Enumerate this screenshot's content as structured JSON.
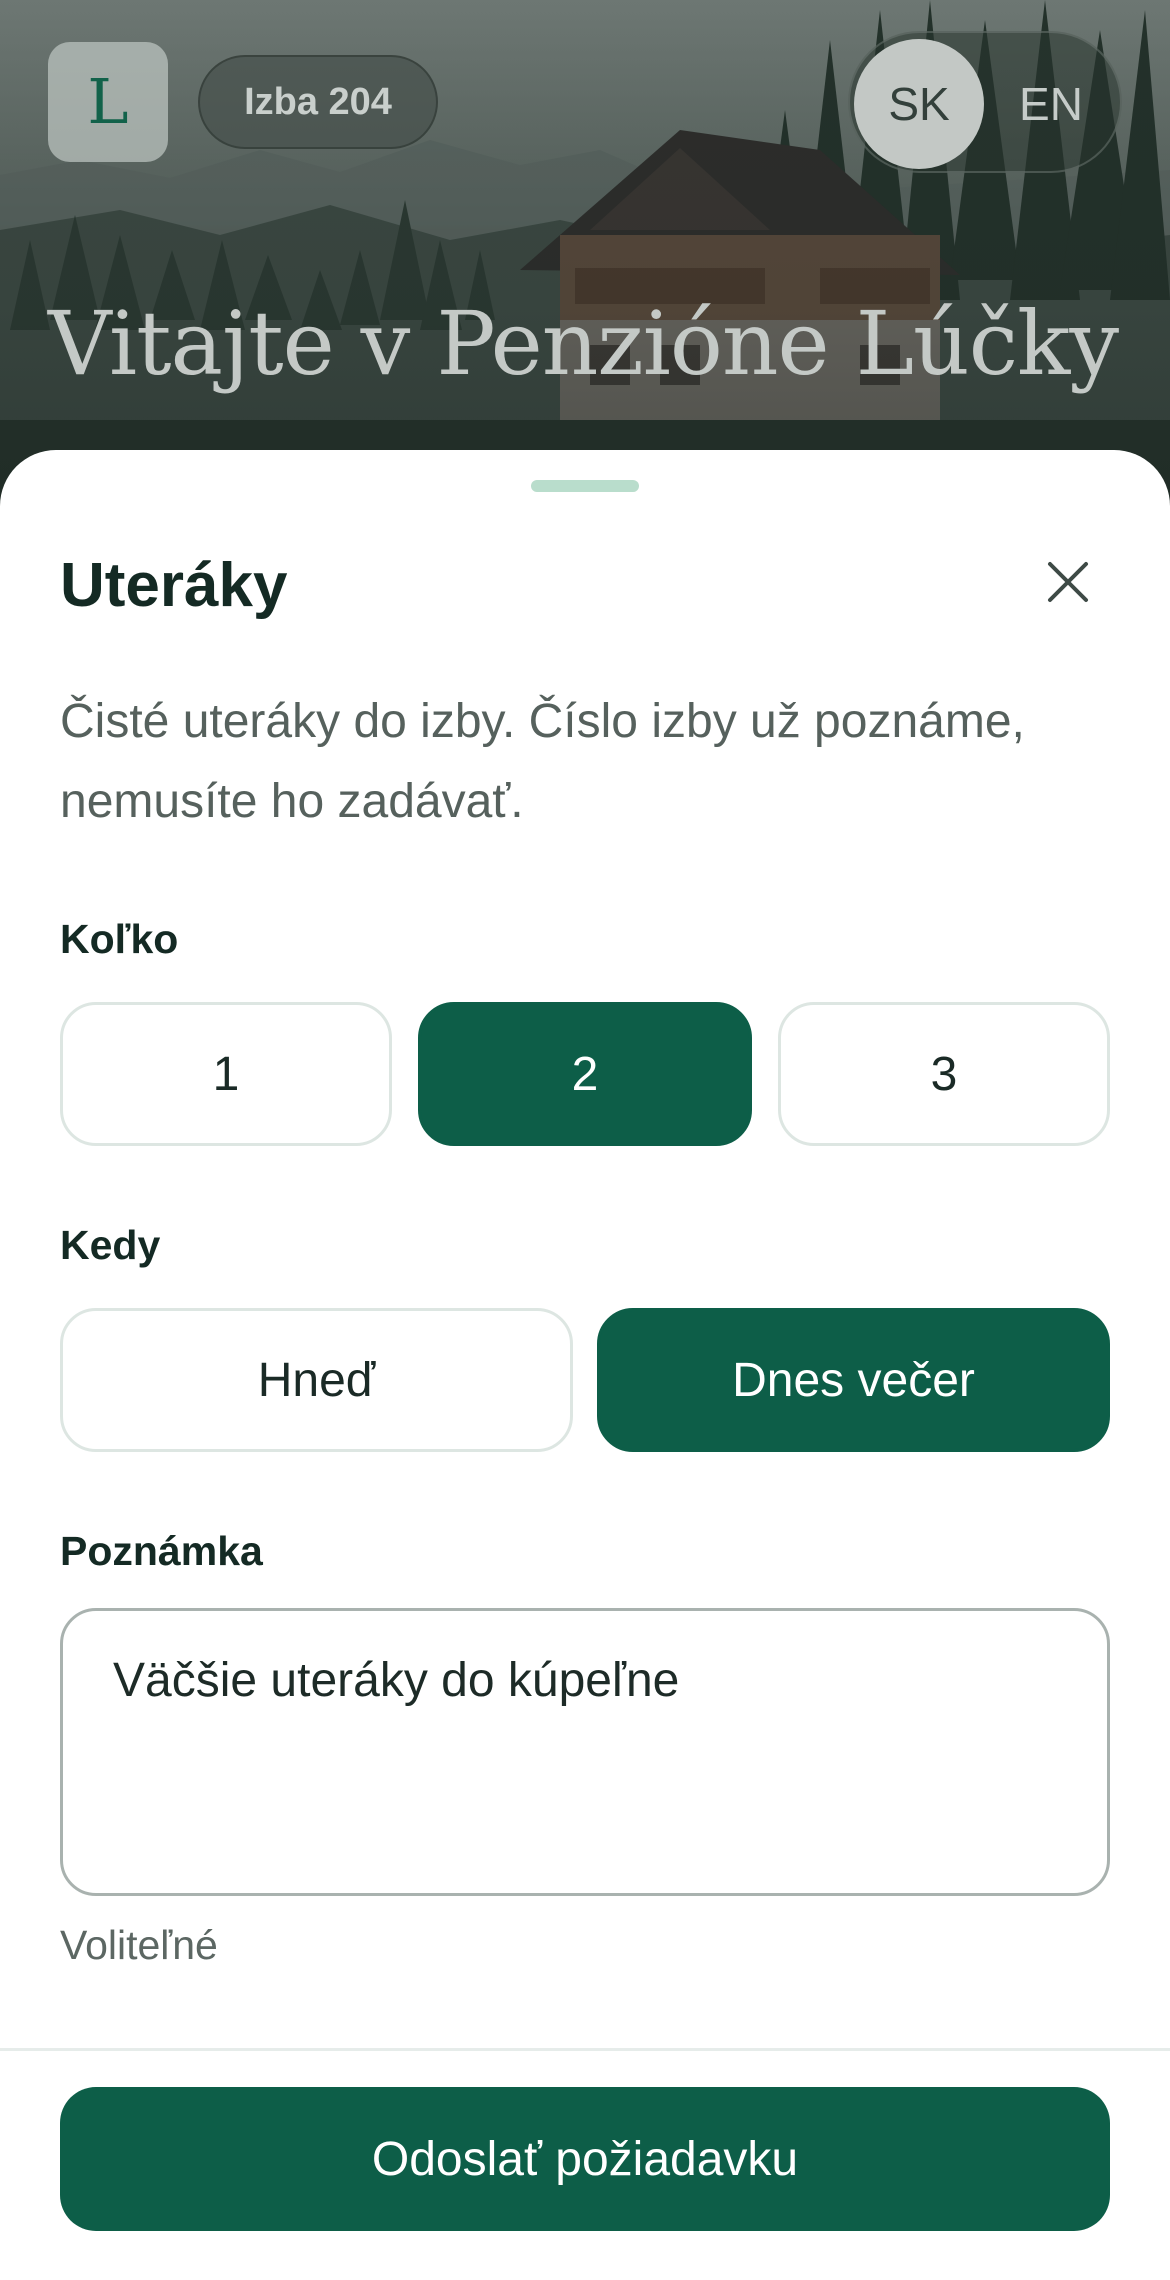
{
  "header": {
    "logo_letter": "L",
    "room_badge": "Izba 204",
    "language": {
      "options": [
        "SK",
        "EN"
      ],
      "selected": "SK"
    },
    "welcome_title": "Vitajte v Penzióne Lúčky"
  },
  "sheet": {
    "title": "Uteráky",
    "description": "Čisté uteráky do izby. Číslo izby už poznáme, nemusíte ho zadávať.",
    "quantity": {
      "label": "Koľko",
      "options": [
        "1",
        "2",
        "3"
      ],
      "selected": "2"
    },
    "timing": {
      "label": "Kedy",
      "options": [
        "Hneď",
        "Dnes večer"
      ],
      "selected": "Dnes večer"
    },
    "note": {
      "label": "Poznámka",
      "value": "Väčšie uteráky do kúpeľne",
      "hint": "Voliteľné"
    },
    "submit_label": "Odoslať požiadavku"
  },
  "colors": {
    "accent": "#0d5e48",
    "grabber": "#b9ddcc",
    "border": "#dde6e2"
  },
  "icons": {
    "close": "close-icon"
  }
}
